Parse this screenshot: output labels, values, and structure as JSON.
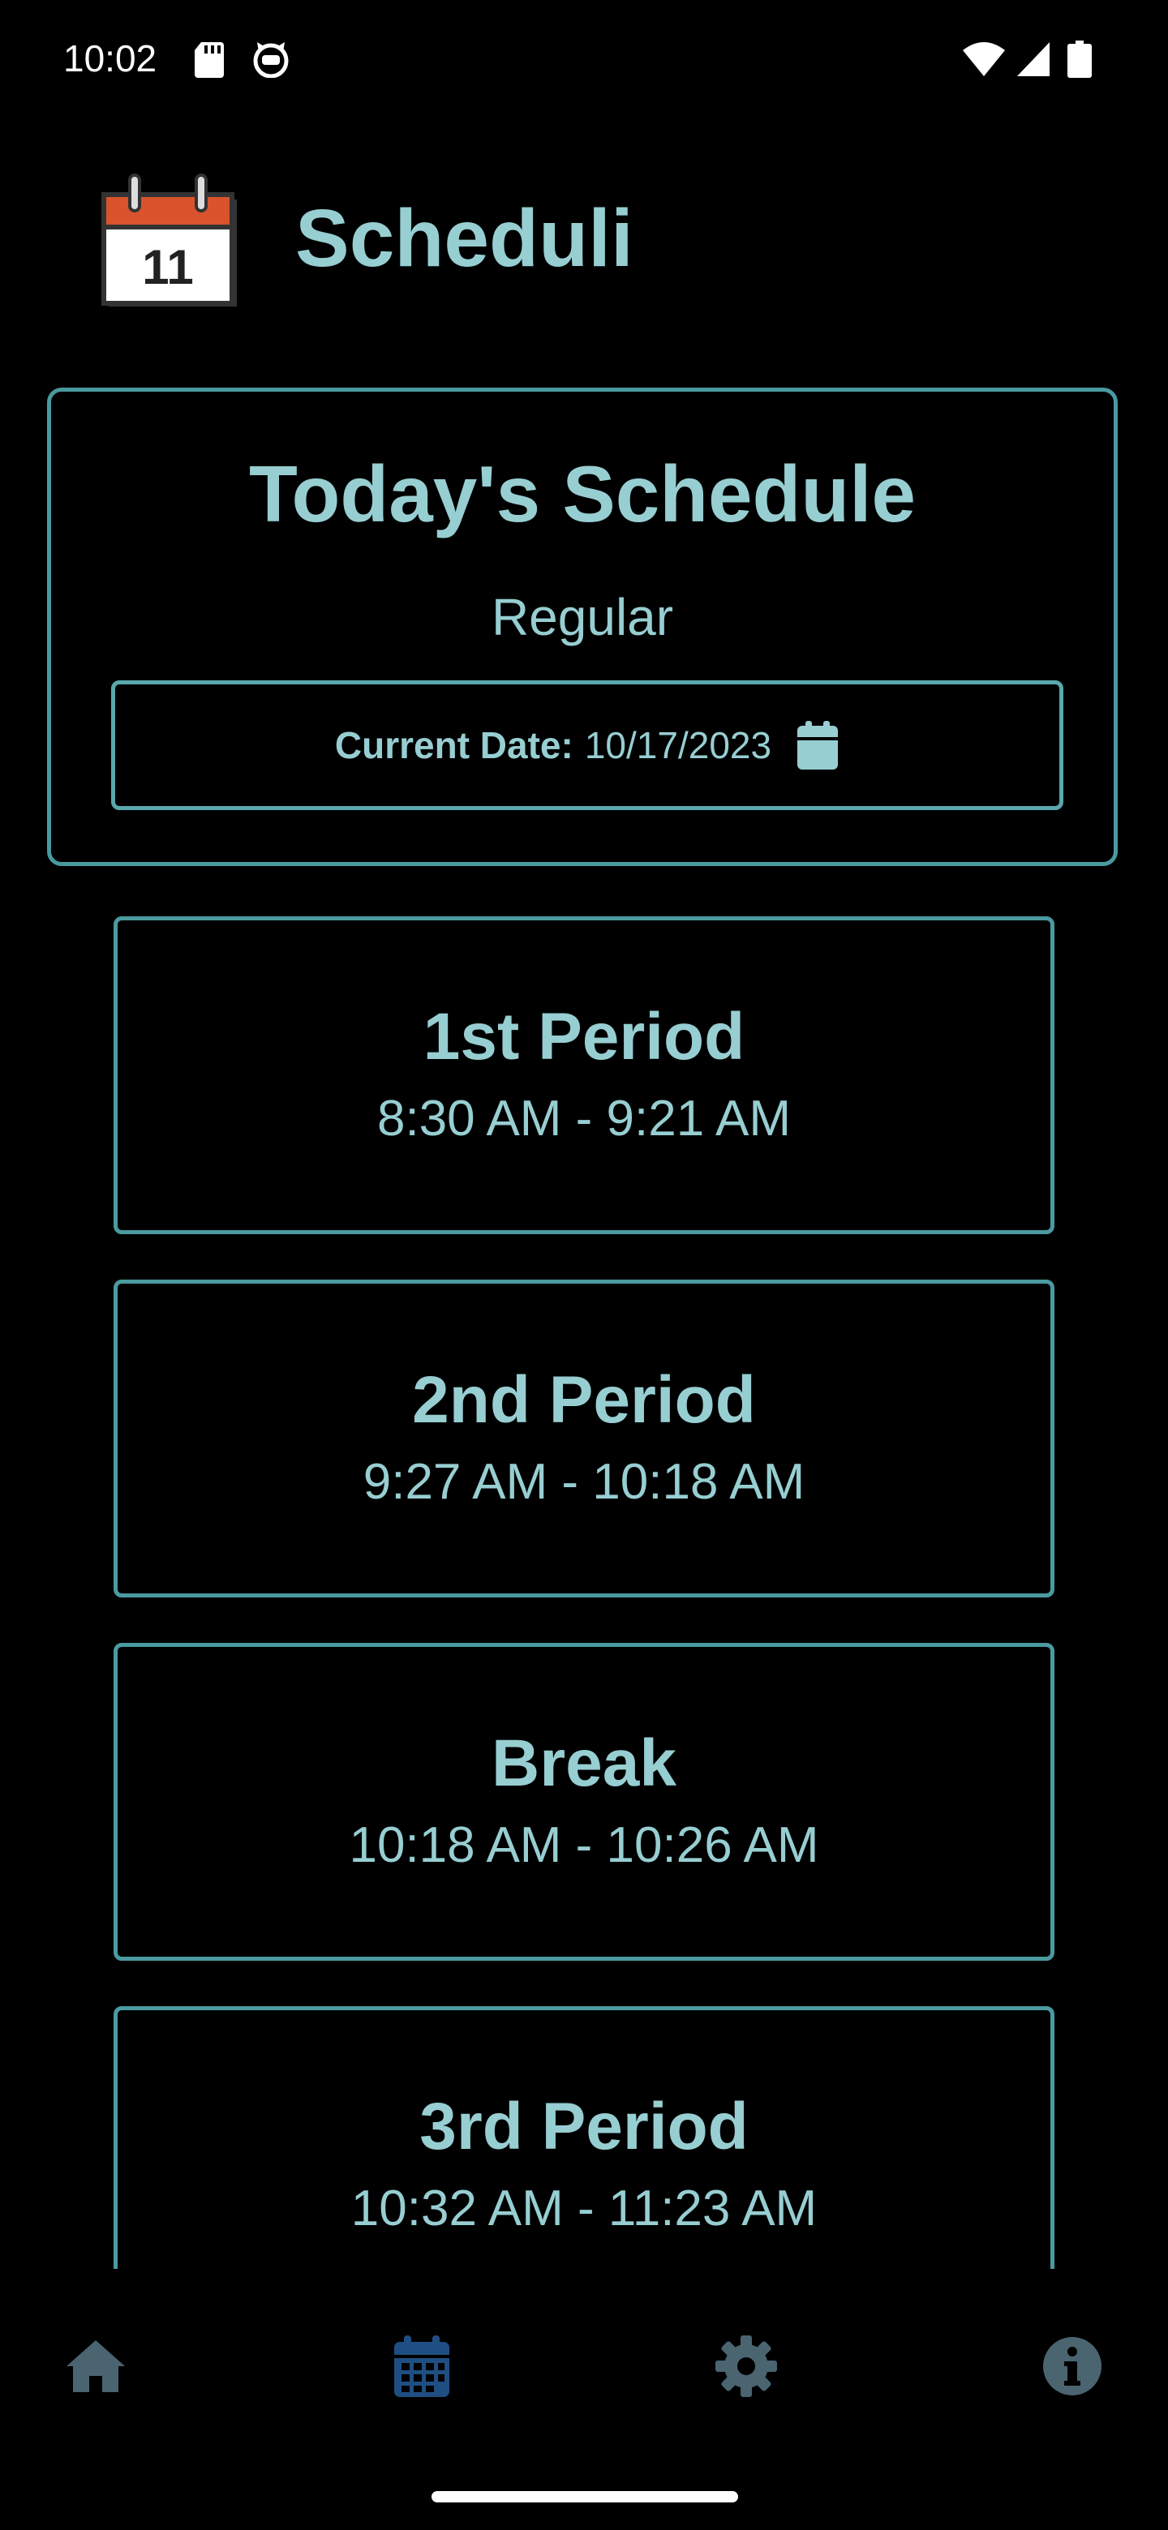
{
  "status_bar": {
    "time": "10:02",
    "icons": [
      "sd-card-icon",
      "cat-notification-icon",
      "wifi-icon",
      "signal-icon",
      "battery-icon"
    ]
  },
  "app": {
    "title": "Scheduli",
    "logo_icon": "calendar-logo-icon",
    "logo_day": "11"
  },
  "today": {
    "title": "Today's Schedule",
    "schedule_type": "Regular",
    "date_label": "Current Date:",
    "date_value": "10/17/2023"
  },
  "periods": [
    {
      "name": "1st Period",
      "time": "8:30 AM - 9:21 AM"
    },
    {
      "name": "2nd Period",
      "time": "9:27 AM - 10:18 AM"
    },
    {
      "name": "Break",
      "time": "10:18 AM - 10:26 AM"
    },
    {
      "name": "3rd Period",
      "time": "10:32 AM - 11:23 AM"
    }
  ],
  "nav": {
    "items": [
      {
        "icon": "home-icon",
        "active": false
      },
      {
        "icon": "calendar-icon",
        "active": true
      },
      {
        "icon": "gear-icon",
        "active": false
      },
      {
        "icon": "info-icon",
        "active": false
      }
    ],
    "active_color": "#1f4f82",
    "inactive_color": "#4a6470"
  },
  "colors": {
    "background": "#000000",
    "accent_text": "#97ced2",
    "border": "#4a9aa0"
  }
}
